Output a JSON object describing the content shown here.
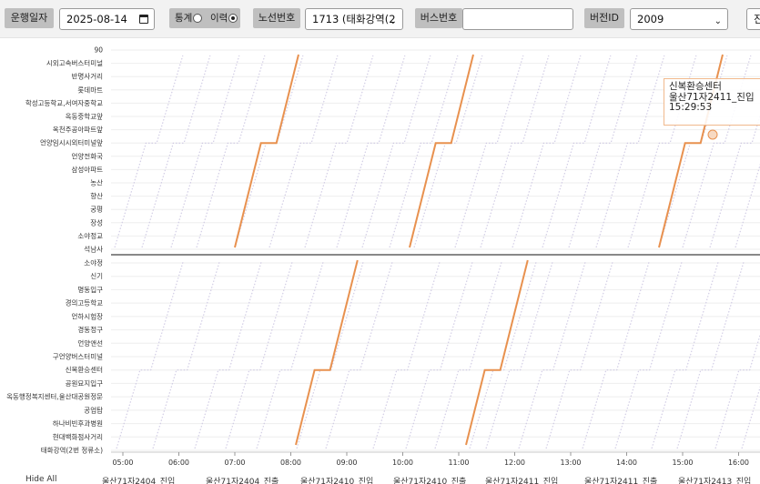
{
  "toolbar": {
    "date_label": "운행일자",
    "date_value": "2025-08-14",
    "mode_stats_label": "통계",
    "mode_history_label": "이력",
    "route_label": "노선번호",
    "route_value": "1713 (태화강역(2",
    "bus_label": "버스번호",
    "bus_value": "",
    "version_label": "버전ID",
    "version_value": "2009",
    "extra_label": "진"
  },
  "tooltip": {
    "line1": "신복환승센터",
    "line2": "울산71자2411_진입",
    "line3": "15:29:53"
  },
  "legend": {
    "items": [
      "Hide All",
      "울산71자2404_진입",
      "울산71자2404_진출",
      "울산71자2410_진입",
      "울산71자2410_진출",
      "울산71자2411_진입",
      "울산71자2411_진출",
      "울산71자2413_진입"
    ]
  },
  "colors": {
    "highlight": "#e8914f",
    "trace": "#c9c3e0",
    "divider": "#888888"
  },
  "chart_data": {
    "type": "line",
    "x": [
      "05:00",
      "06:00",
      "07:00",
      "08:00",
      "09:00",
      "10:00",
      "11:00",
      "12:00",
      "13:00",
      "14:00",
      "15:00",
      "16:00"
    ],
    "stops_upper": [
      "90",
      "시외고속버스터미널",
      "반명사거리",
      "롯데마트",
      "학성고등학교,서여자중학교",
      "옥동중학교앞",
      "옥천주공아파트앞",
      "언양임시시외터미널앞",
      "언양전화국",
      "삼성아파트",
      "농산",
      "향산",
      "궁평",
      "장성",
      "소야정교",
      "석남사"
    ],
    "stops_lower": [
      "소야정",
      "신기",
      "명동입구",
      "경의고등학교",
      "언하시험장",
      "경동정구",
      "언양앤선",
      "구언양버스터미널",
      "신복환승센터",
      "공원묘지입구",
      "옥동행정복지센터,울산대공원정문",
      "공업탑",
      "하나비빈후과병원",
      "현대백화점사거리",
      "태화강역(2번 정류소)"
    ]
  }
}
